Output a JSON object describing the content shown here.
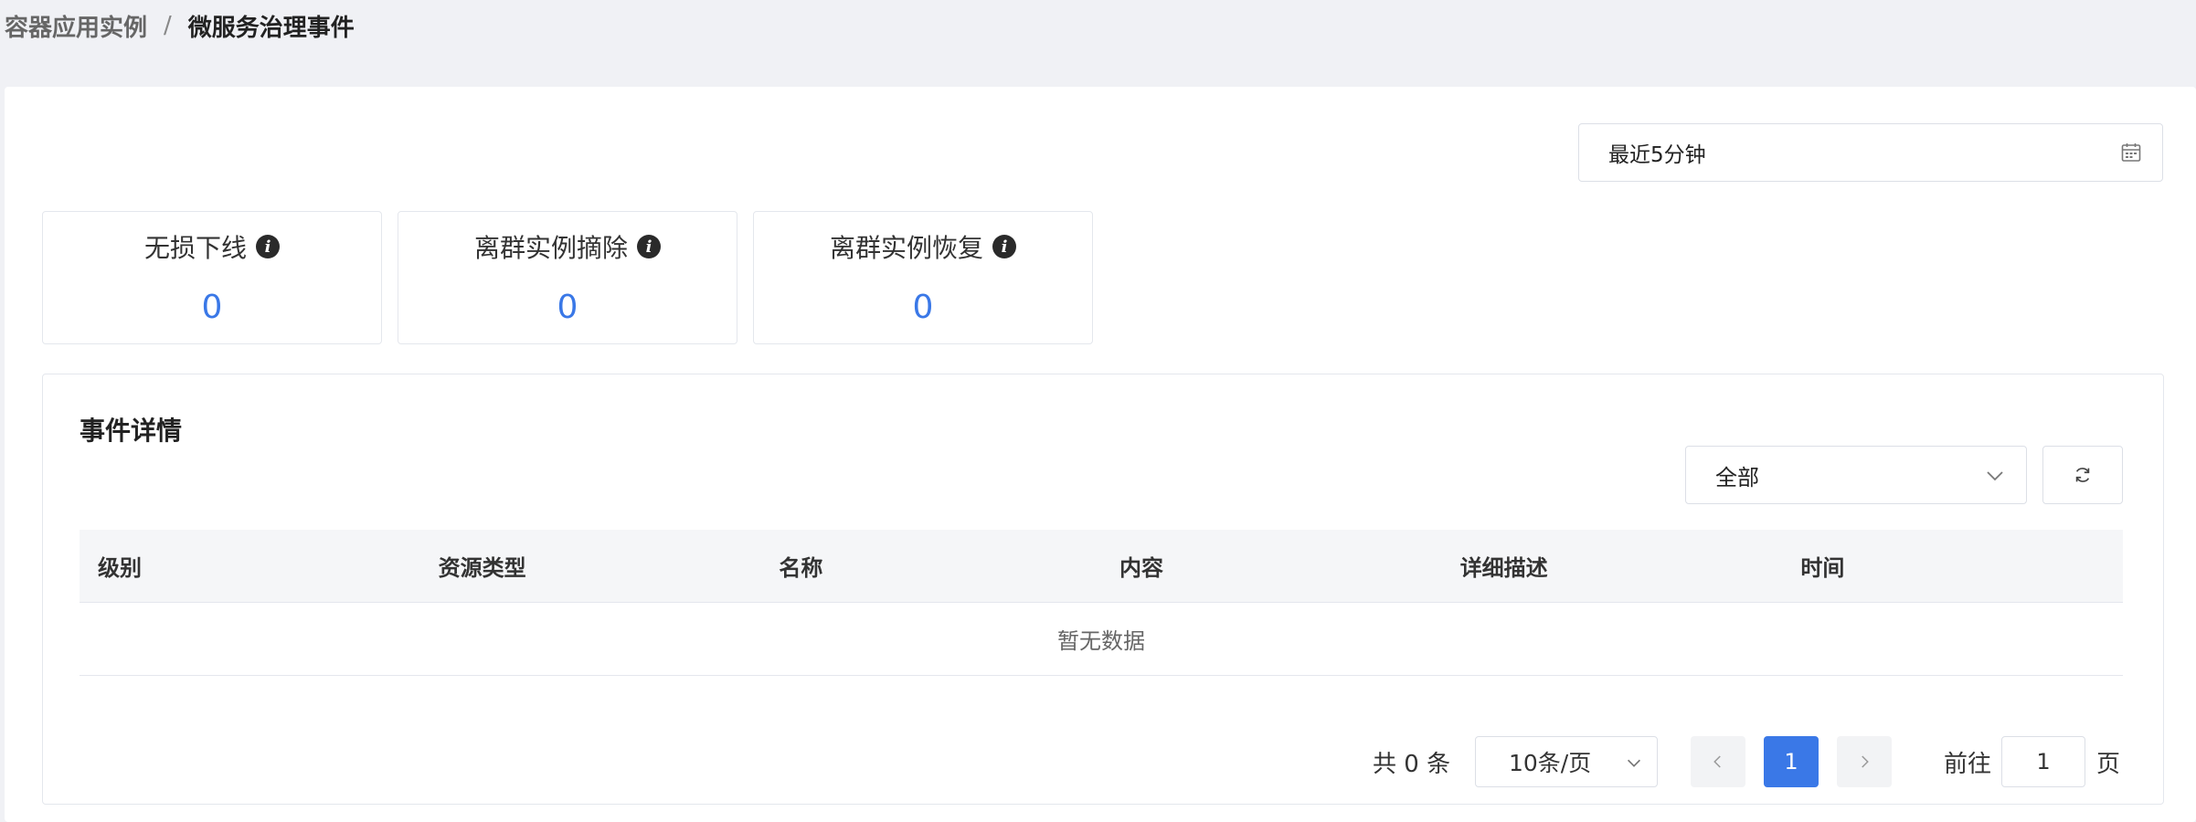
{
  "breadcrumb": {
    "parent": "容器应用实例",
    "separator": "/",
    "current": "微服务治理事件"
  },
  "time_range": {
    "value": "最近5分钟",
    "icon": "calendar-icon"
  },
  "stats": [
    {
      "label": "无损下线",
      "value": "0",
      "icon": "info-icon"
    },
    {
      "label": "离群实例摘除",
      "value": "0",
      "icon": "info-icon"
    },
    {
      "label": "离群实例恢复",
      "value": "0",
      "icon": "info-icon"
    }
  ],
  "events": {
    "title": "事件详情",
    "filter": {
      "value": "全部",
      "icon": "chevron-down-icon"
    },
    "refresh_icon": "refresh-icon",
    "columns": [
      "级别",
      "资源类型",
      "名称",
      "内容",
      "详细描述",
      "时间"
    ],
    "empty_text": "暂无数据"
  },
  "pagination": {
    "total": "共 0 条",
    "page_size": "10条/页",
    "current_page": "1",
    "goto_label": "前往",
    "goto_value": "1",
    "goto_suffix": "页"
  },
  "colors": {
    "accent": "#3a78e7",
    "background": "#f0f1f5"
  }
}
